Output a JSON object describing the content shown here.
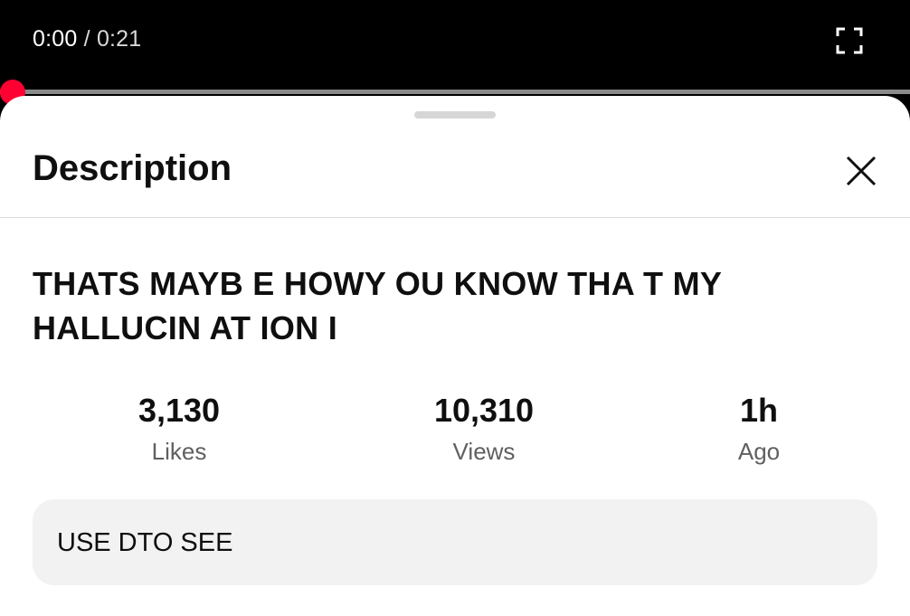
{
  "player": {
    "current_time": "0:00",
    "separator": "/",
    "duration": "0:21",
    "progress_fraction": 0.0,
    "accent_color": "#ff0033",
    "fullscreen_icon": "fullscreen-icon"
  },
  "sheet": {
    "title": "Description",
    "close_icon": "close-icon",
    "video_title": "THATS MAYB E HOWY OU KNOW THA T MY HALLUCIN AT ION I",
    "stats": [
      {
        "value": "3,130",
        "label": "Likes"
      },
      {
        "value": "10,310",
        "label": "Views"
      },
      {
        "value": "1h",
        "label": "Ago"
      }
    ],
    "description": "USE DTO SEE"
  }
}
